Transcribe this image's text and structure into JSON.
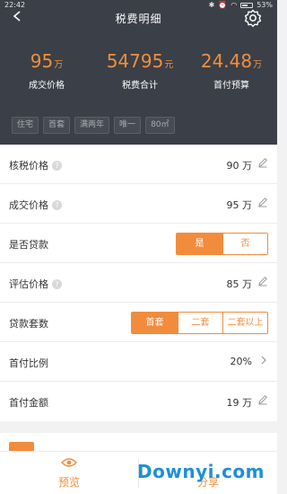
{
  "status_bar": {
    "time": "22:42",
    "battery": "53%"
  },
  "header": {
    "title": "税费明细",
    "stats": [
      {
        "value": "95",
        "unit": "万",
        "label": "成交价格"
      },
      {
        "value": "54795",
        "unit": "元",
        "label": "税费合计"
      },
      {
        "value": "24.48",
        "unit": "万",
        "label": "首付预算"
      }
    ],
    "tags": [
      "住宅",
      "首套",
      "满两年",
      "唯一",
      "80㎡"
    ]
  },
  "rows": {
    "tax_price": {
      "label": "核税价格",
      "value": "90 万"
    },
    "deal_price": {
      "label": "成交价格",
      "value": "95 万"
    },
    "loan": {
      "label": "是否贷款",
      "options": [
        "是",
        "否"
      ],
      "selected": "是"
    },
    "appraisal": {
      "label": "评估价格",
      "value": "85 万"
    },
    "loan_count": {
      "label": "贷款套数",
      "options": [
        "首套",
        "二套",
        "二套以上"
      ],
      "selected": "首套"
    },
    "down_ratio": {
      "label": "首付比例",
      "value": "20%"
    },
    "down_amount": {
      "label": "首付金额",
      "value": "19 万"
    }
  },
  "bottom_bar": {
    "preview": "预览",
    "share": "分享",
    "watermark": "Downyi.com"
  },
  "colors": {
    "accent": "#f28c3d",
    "header_bg": "#3b3f47"
  }
}
